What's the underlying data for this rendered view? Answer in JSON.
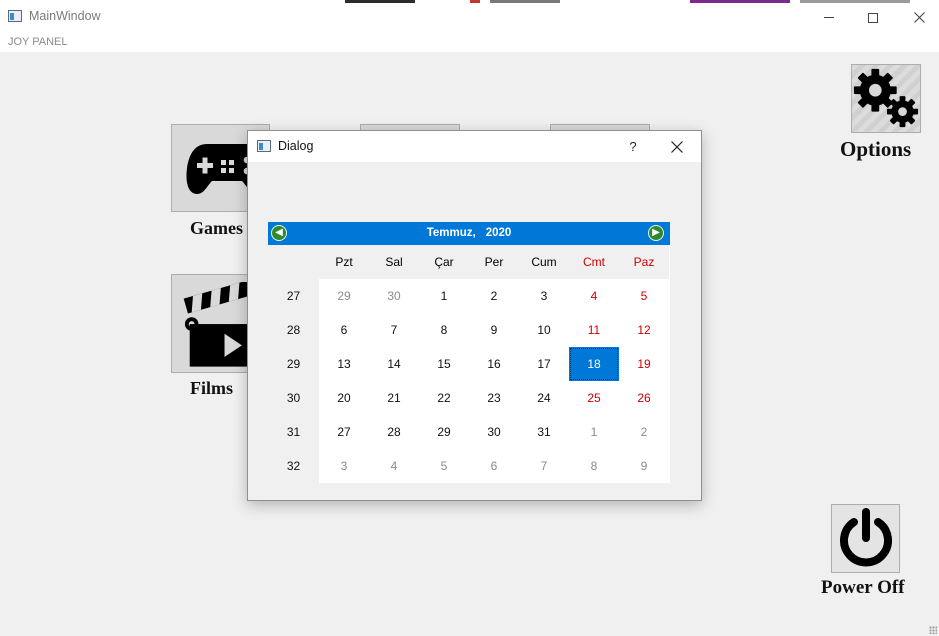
{
  "window": {
    "title": "MainWindow",
    "menu": [
      "JOY PANEL"
    ],
    "controls": {
      "minimize": "minimize",
      "maximize": "maximize",
      "close": "close"
    }
  },
  "tiles": {
    "games": {
      "label": "Games",
      "icon": "gamepad-icon"
    },
    "films": {
      "label": "Films",
      "icon": "clapperboard-icon"
    },
    "options": {
      "label": "Options",
      "icon": "gears-icon"
    },
    "power": {
      "label": "Power Off",
      "icon": "power-icon"
    }
  },
  "dialog": {
    "title": "Dialog",
    "help": "?",
    "calendar": {
      "month": "Temmuz,",
      "year": "2020",
      "weekdays": [
        "Pzt",
        "Sal",
        "Çar",
        "Per",
        "Cum",
        "Cmt",
        "Paz"
      ],
      "weekend_color": "#cc0000",
      "accent_color": "#0078d7",
      "selected_day": "18",
      "weeks": [
        {
          "week": "27",
          "days": [
            "29",
            "30",
            "1",
            "2",
            "3",
            "4",
            "5"
          ]
        },
        {
          "week": "28",
          "days": [
            "6",
            "7",
            "8",
            "9",
            "10",
            "11",
            "12"
          ]
        },
        {
          "week": "29",
          "days": [
            "13",
            "14",
            "15",
            "16",
            "17",
            "18",
            "19"
          ]
        },
        {
          "week": "30",
          "days": [
            "20",
            "21",
            "22",
            "23",
            "24",
            "25",
            "26"
          ]
        },
        {
          "week": "31",
          "days": [
            "27",
            "28",
            "29",
            "30",
            "31",
            "1",
            "2"
          ]
        },
        {
          "week": "32",
          "days": [
            "3",
            "4",
            "5",
            "6",
            "7",
            "8",
            "9"
          ]
        }
      ]
    }
  }
}
